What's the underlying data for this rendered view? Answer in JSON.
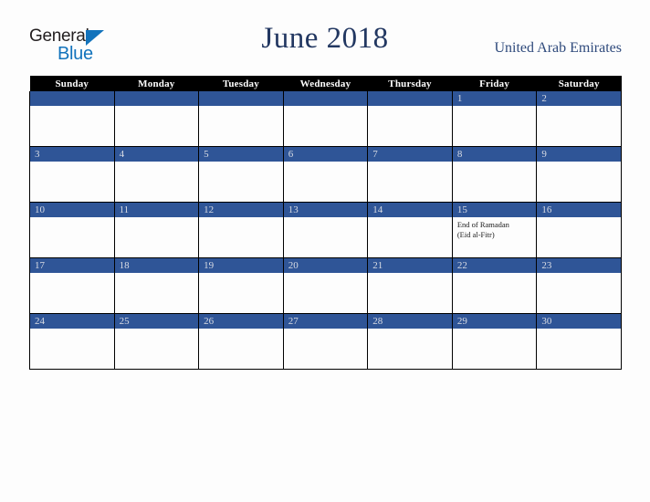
{
  "brand": {
    "name_part1": "General",
    "name_part2": "Blue",
    "triangle_icon": "triangle-right-icon",
    "colors": {
      "dark": "#231f20",
      "blue": "#1273bc"
    }
  },
  "header": {
    "title": "June 2018",
    "country": "United Arab Emirates",
    "title_color": "#223761",
    "country_color": "#2f4a7c"
  },
  "theme": {
    "header_row_bg": "#000000",
    "header_row_text": "#ffffff",
    "day_bar_bg": "#2f5597",
    "day_bar_text": "#d9dce4",
    "cell_bg": "#fdfdfd",
    "grid_line": "#000000",
    "page_bg": "#fdfdfd"
  },
  "weekdays": [
    "Sunday",
    "Monday",
    "Tuesday",
    "Wednesday",
    "Thursday",
    "Friday",
    "Saturday"
  ],
  "weeks": [
    [
      {
        "day": "",
        "events": []
      },
      {
        "day": "",
        "events": []
      },
      {
        "day": "",
        "events": []
      },
      {
        "day": "",
        "events": []
      },
      {
        "day": "",
        "events": []
      },
      {
        "day": "1",
        "events": []
      },
      {
        "day": "2",
        "events": []
      }
    ],
    [
      {
        "day": "3",
        "events": []
      },
      {
        "day": "4",
        "events": []
      },
      {
        "day": "5",
        "events": []
      },
      {
        "day": "6",
        "events": []
      },
      {
        "day": "7",
        "events": []
      },
      {
        "day": "8",
        "events": []
      },
      {
        "day": "9",
        "events": []
      }
    ],
    [
      {
        "day": "10",
        "events": []
      },
      {
        "day": "11",
        "events": []
      },
      {
        "day": "12",
        "events": []
      },
      {
        "day": "13",
        "events": []
      },
      {
        "day": "14",
        "events": []
      },
      {
        "day": "15",
        "events": [
          "End of Ramadan",
          "(Eid al-Fitr)"
        ]
      },
      {
        "day": "16",
        "events": []
      }
    ],
    [
      {
        "day": "17",
        "events": []
      },
      {
        "day": "18",
        "events": []
      },
      {
        "day": "19",
        "events": []
      },
      {
        "day": "20",
        "events": []
      },
      {
        "day": "21",
        "events": []
      },
      {
        "day": "22",
        "events": []
      },
      {
        "day": "23",
        "events": []
      }
    ],
    [
      {
        "day": "24",
        "events": []
      },
      {
        "day": "25",
        "events": []
      },
      {
        "day": "26",
        "events": []
      },
      {
        "day": "27",
        "events": []
      },
      {
        "day": "28",
        "events": []
      },
      {
        "day": "29",
        "events": []
      },
      {
        "day": "30",
        "events": []
      }
    ]
  ]
}
